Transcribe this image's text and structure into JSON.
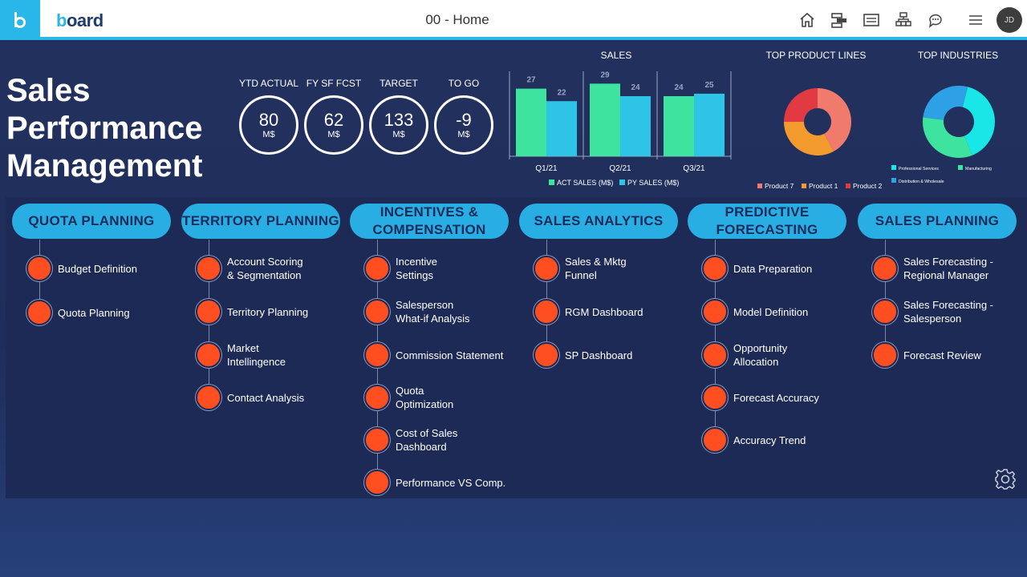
{
  "topbar": {
    "logo_b": "b",
    "logo_rest": "oard",
    "page_title": "00 - Home",
    "avatar_initials": "JD",
    "icons": [
      "home-icon",
      "hierarchy-icon",
      "screen-icon",
      "org-chart-icon",
      "chat-icon",
      "menu-icon"
    ]
  },
  "header": {
    "title_lines": [
      "Sales",
      "Performance",
      "Management"
    ],
    "kpis": [
      {
        "label": "YTD ACTUAL",
        "value": "80",
        "unit": "M$"
      },
      {
        "label": "FY SF FCST",
        "value": "62",
        "unit": "M$"
      },
      {
        "label": "TARGET",
        "value": "133",
        "unit": "M$"
      },
      {
        "label": "TO GO",
        "value": "-9",
        "unit": "M$"
      }
    ]
  },
  "colors": {
    "accent": "#29aee4",
    "node": "#ff4e1f",
    "act_sales": "#3fe3a0",
    "py_sales": "#2ec4e6"
  },
  "chart_data": [
    {
      "type": "bar",
      "title": "SALES",
      "categories": [
        "Q1/21",
        "Q2/21",
        "Q3/21"
      ],
      "series": [
        {
          "name": "ACT SALES (M$)",
          "values": [
            27,
            29,
            24
          ],
          "color": "#3fe3a0"
        },
        {
          "name": "PY SALES (M$)",
          "values": [
            22,
            24,
            25
          ],
          "color": "#2ec4e6"
        }
      ],
      "ylim": [
        0,
        32
      ],
      "legend": "bottom"
    },
    {
      "type": "pie",
      "title": "TOP PRODUCT LINES",
      "labels": [
        "Product 7",
        "Product 1",
        "Product 2"
      ],
      "values": [
        42,
        33,
        25
      ],
      "colors": [
        "#f07a6b",
        "#f29a2e",
        "#e23a43"
      ],
      "legend": "bottom"
    },
    {
      "type": "pie",
      "title": "TOP INDUSTRIES",
      "labels": [
        "Professional Services",
        "Manufacturing",
        "Distribution & Wholesale"
      ],
      "values": [
        40,
        33,
        27
      ],
      "colors": [
        "#19e6e6",
        "#3fe3a0",
        "#2ea0e6"
      ],
      "legend": "bottom"
    }
  ],
  "columns": [
    {
      "header": "QUOTA PLANNING",
      "items": [
        "Budget Definition",
        "Quota Planning"
      ]
    },
    {
      "header": "TERRITORY PLANNING",
      "items": [
        "Account Scoring\n& Segmentation",
        "Territory Planning",
        "Market\nIntellingence",
        "Contact Analysis"
      ]
    },
    {
      "header": "INCENTIVES & COMPENSATION",
      "items": [
        "Incentive\nSettings",
        "Salesperson\nWhat-if Analysis",
        "Commission Statement",
        "Quota\nOptimization",
        "Cost of Sales\nDashboard",
        "Performance VS Comp."
      ]
    },
    {
      "header": "SALES ANALYTICS",
      "items": [
        "Sales & Mktg\nFunnel",
        "RGM Dashboard",
        "SP Dashboard"
      ]
    },
    {
      "header": "PREDICTIVE FORECASTING",
      "items": [
        "Data Preparation",
        "Model Definition",
        "Opportunity\nAllocation",
        "Forecast Accuracy",
        "Accuracy Trend"
      ]
    },
    {
      "header": "SALES PLANNING",
      "items": [
        "Sales Forecasting -\nRegional Manager",
        "Sales Forecasting -\nSalesperson",
        "Forecast Review"
      ]
    }
  ]
}
